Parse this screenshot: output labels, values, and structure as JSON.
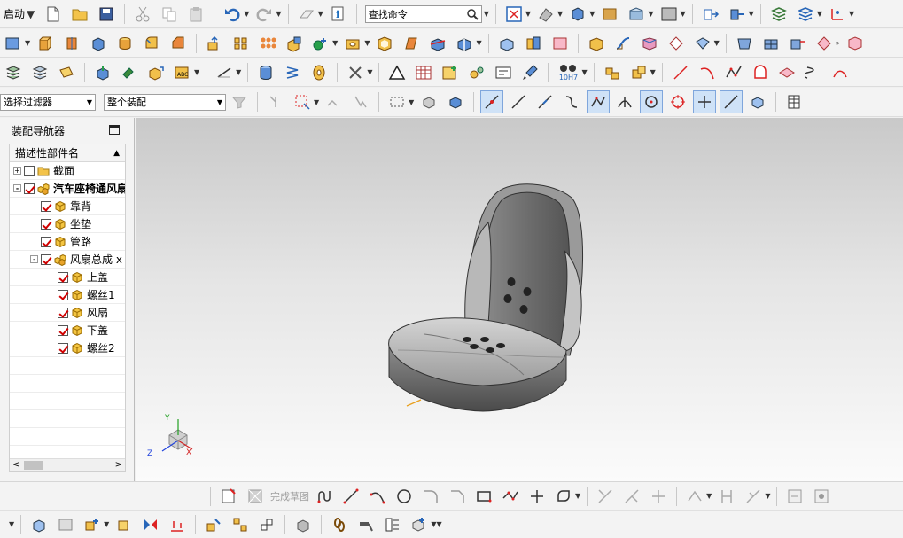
{
  "toolbar1": {
    "start_label": "启动",
    "search_placeholder": "查找命令"
  },
  "filter_bar": {
    "selection_filter": "选择过滤器",
    "scope": "整个装配"
  },
  "navigator": {
    "title": "装配导航器",
    "column_header": "描述性部件名",
    "tree": [
      {
        "label": "截面",
        "indent": 0,
        "expander": "+",
        "checked": false,
        "icon": "folder-icon",
        "bold": false
      },
      {
        "label": "汽车座椅通风扇",
        "indent": 0,
        "expander": "-",
        "checked": true,
        "icon": "assembly-icon",
        "bold": true
      },
      {
        "label": "靠背",
        "indent": 1,
        "expander": "",
        "checked": true,
        "icon": "part-icon",
        "bold": false
      },
      {
        "label": "坐垫",
        "indent": 1,
        "expander": "",
        "checked": true,
        "icon": "part-icon",
        "bold": false
      },
      {
        "label": "管路",
        "indent": 1,
        "expander": "",
        "checked": true,
        "icon": "part-icon",
        "bold": false
      },
      {
        "label": "风扇总成 x",
        "indent": 1,
        "expander": "-",
        "checked": true,
        "icon": "assembly-icon",
        "bold": false
      },
      {
        "label": "上盖",
        "indent": 2,
        "expander": "",
        "checked": true,
        "icon": "part-icon",
        "bold": false
      },
      {
        "label": "螺丝1",
        "indent": 2,
        "expander": "",
        "checked": true,
        "icon": "part-icon",
        "bold": false
      },
      {
        "label": "风扇",
        "indent": 2,
        "expander": "",
        "checked": true,
        "icon": "part-icon",
        "bold": false
      },
      {
        "label": "下盖",
        "indent": 2,
        "expander": "",
        "checked": true,
        "icon": "part-icon",
        "bold": false
      },
      {
        "label": "螺丝2",
        "indent": 2,
        "expander": "",
        "checked": true,
        "icon": "part-icon",
        "bold": false
      }
    ]
  },
  "viewport": {
    "axis_labels": {
      "x": "X",
      "y": "Y",
      "z": "Z"
    },
    "axis_colors": {
      "x": "#d22222",
      "y": "#22a022",
      "z": "#2244dd"
    }
  },
  "sketch_bar": {
    "finish_sketch": "完成草图"
  },
  "toolbar3": {
    "fit_label": "10H7"
  },
  "colors": {
    "accent_blue": "#1f6fbf",
    "check_red": "#d00000",
    "part_yellow": "#f2c230",
    "seat_gray": "#6e6e6e"
  }
}
